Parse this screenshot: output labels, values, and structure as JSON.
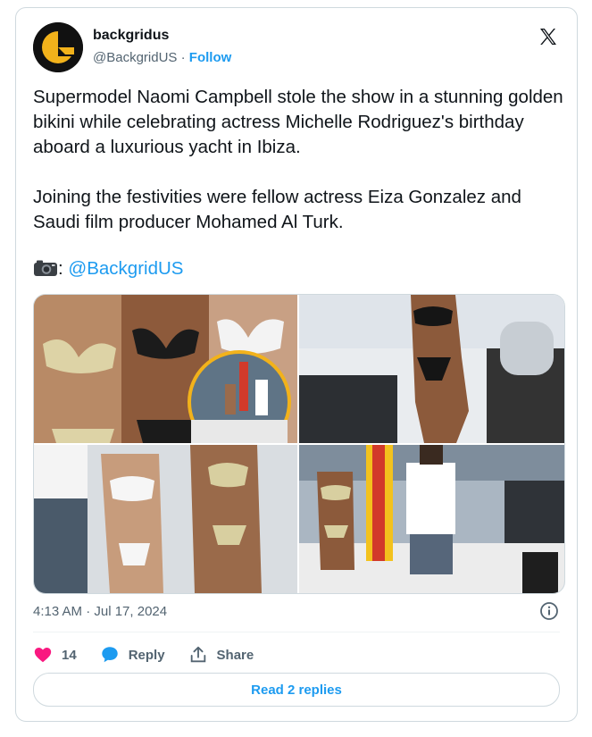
{
  "author": {
    "display_name": "backgridus",
    "handle": "@BackgridUS",
    "separator": "·",
    "follow_label": "Follow"
  },
  "tweet": {
    "text": "Supermodel Naomi Campbell stole the show in a stunning golden bikini while celebrating actress Michelle Rodriguez's birthday aboard a luxurious yacht in Ibiza.\n\nJoining the festivities were fellow actress Eiza Gonzalez and Saudi film producer Mohamed Al Turk.",
    "credit_separator": ": ",
    "credit_handle": "@BackgridUS"
  },
  "media": {
    "photos": [
      {
        "alt": "photo 1"
      },
      {
        "alt": "photo 2"
      },
      {
        "alt": "photo 3"
      },
      {
        "alt": "photo 4"
      }
    ]
  },
  "timestamp": "4:13 AM · Jul 17, 2024",
  "actions": {
    "like_count": "14",
    "reply_label": "Reply",
    "share_label": "Share"
  },
  "read_replies_label": "Read 2 replies",
  "icons": {
    "logo": "x-logo-icon",
    "camera": "camera-icon",
    "info": "info-icon",
    "like": "heart-icon",
    "reply": "speech-bubble-icon",
    "share": "share-upload-icon"
  },
  "colors": {
    "accent": "#1d9bf0",
    "like": "#f91880",
    "text": "#0f1419",
    "muted": "#536471"
  }
}
